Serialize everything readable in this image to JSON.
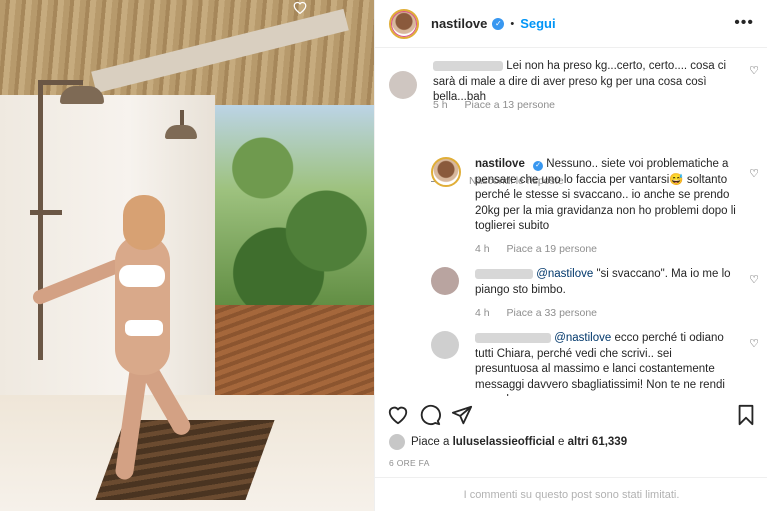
{
  "header": {
    "username": "nastilove",
    "verified_mark": "✓",
    "separator": "•",
    "follow_label": "Segui",
    "more_label": "•••"
  },
  "comments": [
    {
      "user_hidden": true,
      "text": "Lei non ha preso kg...certo, certo.... cosa ci sarà di male a dire di aver preso kg per una cosa così bella...bah",
      "time": "5 h",
      "likes": "Piace a 13 persone"
    },
    {
      "user": "nastilove",
      "text": "Nessuno.. siete voi problematiche a pensare che uno lo faccia per vantarsi😅 soltanto perché le stesse si svaccano.. io anche se prendo 20kg per la mia gravidanza non ho problemi dopo li toglierei subito",
      "time": "4 h",
      "likes": "Piace a 19 persone"
    },
    {
      "user_hidden": true,
      "mention": "@nastilove",
      "text": "\"si svaccano\". Ma io me lo piango sto bimbo.",
      "time": "4 h",
      "likes": "Piace a 33 persone"
    },
    {
      "user_hidden": true,
      "mention": "@nastilove",
      "text": "ecco perché ti odiano tutti Chiara, perché vedi che scrivi.. sei presuntuosa al massimo e lanci costantemente messaggi davvero sbagliatissimi! Non te ne rendi neanche"
    }
  ],
  "hide_replies_label": "Nascondi le risposte",
  "likes": {
    "prefix": "Piace a ",
    "user": "luluselassieofficial",
    "middle": " e ",
    "others": "altri 61,339"
  },
  "date": "6 ORE FA",
  "comments_limited": "I commenti su questo post sono stati limitati.",
  "icons": {
    "heart": "heart-icon",
    "comment": "comment-icon",
    "share": "share-icon",
    "save": "bookmark-icon"
  },
  "colors": {
    "accent": "#0095f6",
    "verified": "#3897f0",
    "mention": "#00376b",
    "muted": "#8e8e8e"
  }
}
